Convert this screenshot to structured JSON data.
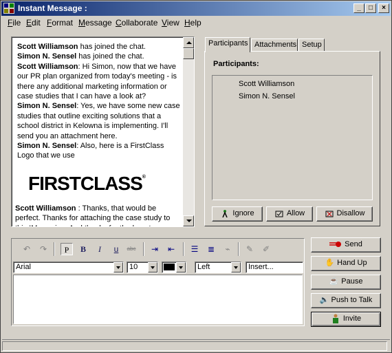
{
  "window": {
    "title": "Instant Message :",
    "minimize": "_",
    "maximize": "□",
    "close": "×"
  },
  "menu": {
    "items": [
      {
        "label": "File",
        "key": "F",
        "rest": "ile"
      },
      {
        "label": "Edit",
        "key": "E",
        "rest": "dit"
      },
      {
        "label": "Format",
        "key": "F",
        "rest": "ormat"
      },
      {
        "label": "Message",
        "key": "M",
        "rest": "essage"
      },
      {
        "label": "Collaborate",
        "key": "C",
        "rest": "ollaborate"
      },
      {
        "label": "View",
        "key": "V",
        "rest": "iew"
      },
      {
        "label": "Help",
        "key": "H",
        "rest": "elp"
      }
    ]
  },
  "chat": {
    "messages": [
      {
        "sender": "Scott Williamson",
        "text": " has joined the chat."
      },
      {
        "sender": "Simon N. Sensel",
        "text": " has joined the chat."
      },
      {
        "sender": "Scott Williamson",
        "text": ": Hi Simon, now that we have our PR plan organized from today's meeting - is there any additional marketing information or case studies that I can have a look at?"
      },
      {
        "sender": "Simon N. Sensel",
        "text": ": Yes, we have some new case studies that outline exciting solutions that a school district in Kelowna is implementing. I'll send you an attachment here."
      },
      {
        "sender": "Simon N. Sensel",
        "text": ": Also, here is a FirstClass Logo that we use"
      }
    ],
    "logo_text": "FIRSTCLASS",
    "logo_mark": "®",
    "after_logo": {
      "sender": "Scott Williamson",
      "text": " : Thanks, that would be perfect. Thanks for attaching the case study to this IM session. And thanks for the logo too."
    }
  },
  "tabs": [
    {
      "label": "Participants",
      "active": true
    },
    {
      "label": "Attachments",
      "active": false
    },
    {
      "label": "Setup",
      "active": false
    }
  ],
  "participants": {
    "heading": "Participants:",
    "list": [
      "Scott Williamson",
      "Simon N. Sensel"
    ],
    "buttons": {
      "ignore": "Ignore",
      "allow": "Allow",
      "disallow": "Disallow"
    }
  },
  "compose": {
    "font": "Arial",
    "size": "10",
    "color": "#000000",
    "align": "Left",
    "insert": "Insert...",
    "toolbar": {
      "p": "P",
      "bold": "B",
      "italic": "I",
      "underline": "u",
      "strike": "abc"
    }
  },
  "actions": {
    "send": "Send",
    "hand_up": "Hand Up",
    "pause": "Pause",
    "push_to_talk": "Push to Talk",
    "invite": "Invite"
  },
  "colors": {
    "title_gradient_start": "#0a246a",
    "title_gradient_end": "#a6caf0",
    "face": "#d4d0c8",
    "send_icon": "#cc0000"
  }
}
